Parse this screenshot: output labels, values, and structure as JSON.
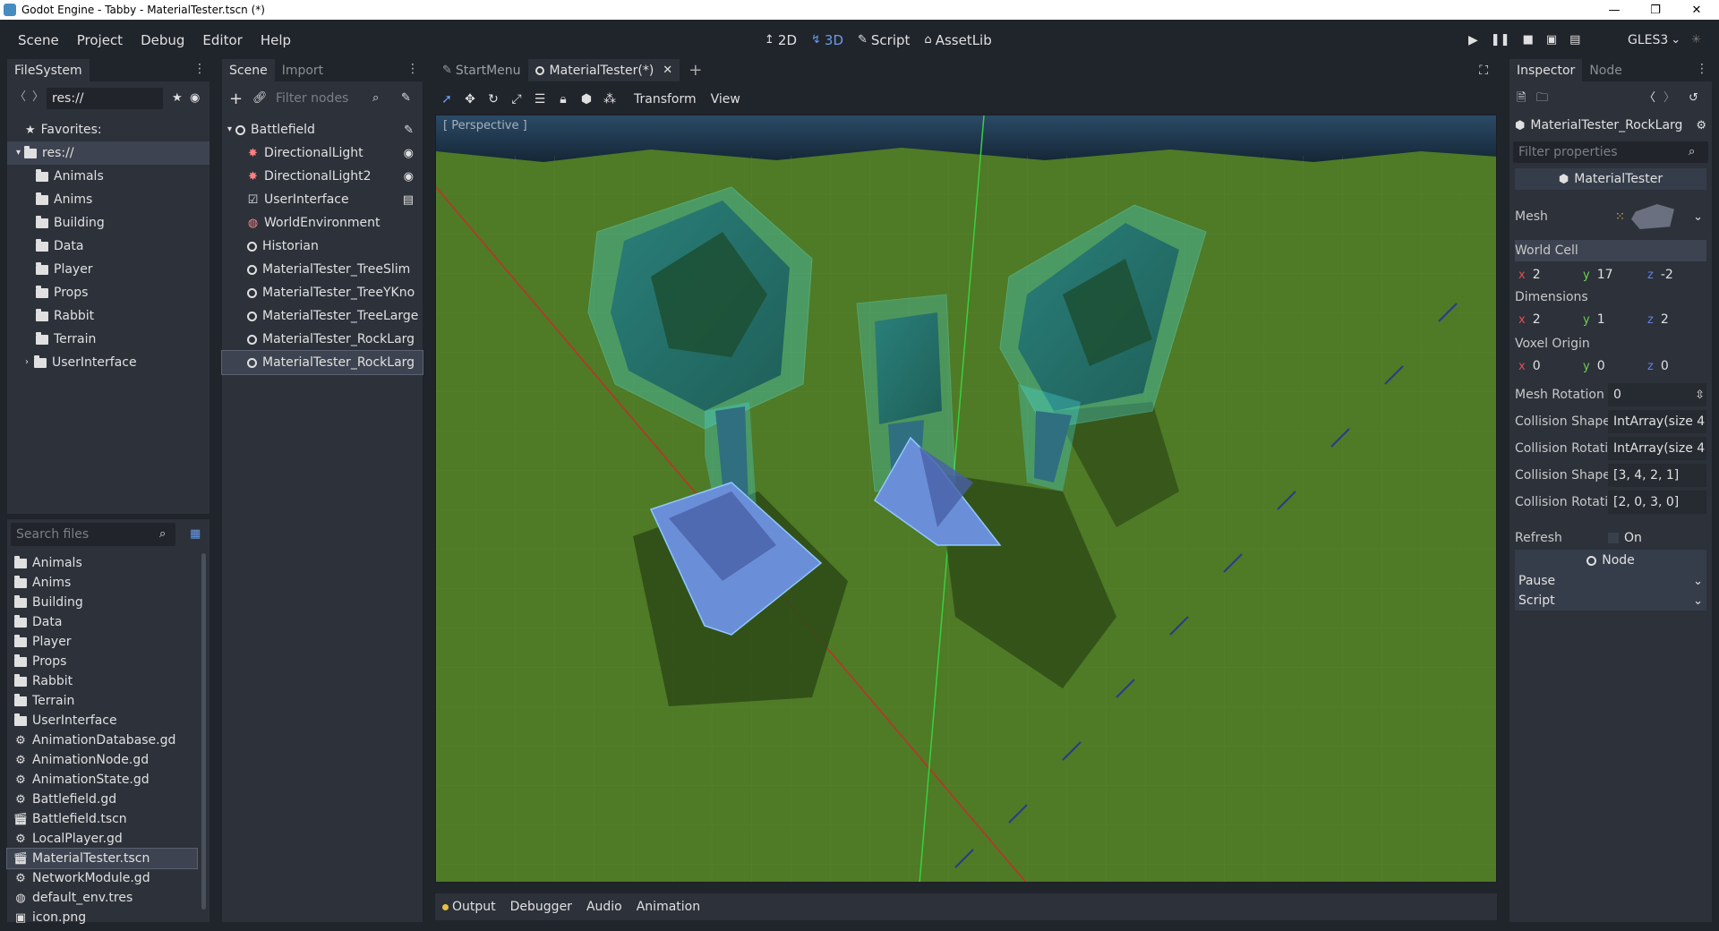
{
  "window": {
    "title": "Godot Engine - Tabby - MaterialTester.tscn (*)",
    "min": "—",
    "max": "❐",
    "close": "✕"
  },
  "menus": [
    "Scene",
    "Project",
    "Debug",
    "Editor",
    "Help"
  ],
  "workspaces": [
    {
      "label": "2D",
      "icon": "↥"
    },
    {
      "label": "3D",
      "icon": "↯"
    },
    {
      "label": "Script",
      "icon": "✎"
    },
    {
      "label": "AssetLib",
      "icon": "⌂"
    }
  ],
  "renderer": "GLES3",
  "filesystem": {
    "tabs": [
      "FileSystem"
    ],
    "path": "res://",
    "favorites_label": "Favorites:",
    "root": "res://",
    "tree": [
      "Animals",
      "Anims",
      "Building",
      "Data",
      "Player",
      "Props",
      "Rabbit",
      "Terrain",
      "UserInterface"
    ],
    "search_placeholder": "Search files",
    "files": [
      {
        "name": "Animals",
        "kind": "folder"
      },
      {
        "name": "Anims",
        "kind": "folder"
      },
      {
        "name": "Building",
        "kind": "folder"
      },
      {
        "name": "Data",
        "kind": "folder"
      },
      {
        "name": "Player",
        "kind": "folder"
      },
      {
        "name": "Props",
        "kind": "folder"
      },
      {
        "name": "Rabbit",
        "kind": "folder"
      },
      {
        "name": "Terrain",
        "kind": "folder"
      },
      {
        "name": "UserInterface",
        "kind": "folder"
      },
      {
        "name": "AnimationDatabase.gd",
        "kind": "script"
      },
      {
        "name": "AnimationNode.gd",
        "kind": "script"
      },
      {
        "name": "AnimationState.gd",
        "kind": "script"
      },
      {
        "name": "Battlefield.gd",
        "kind": "script"
      },
      {
        "name": "Battlefield.tscn",
        "kind": "scene"
      },
      {
        "name": "LocalPlayer.gd",
        "kind": "script"
      },
      {
        "name": "MaterialTester.tscn",
        "kind": "scene"
      },
      {
        "name": "NetworkModule.gd",
        "kind": "script"
      },
      {
        "name": "default_env.tres",
        "kind": "resource"
      },
      {
        "name": "icon.png",
        "kind": "image"
      }
    ]
  },
  "scene": {
    "tabs": [
      "Scene",
      "Import"
    ],
    "filter_placeholder": "Filter nodes",
    "root": "Battlefield",
    "nodes": [
      {
        "name": "DirectionalLight",
        "icon": "light-icon",
        "action": "visibility-icon"
      },
      {
        "name": "DirectionalLight2",
        "icon": "light-icon",
        "action": "visibility-icon"
      },
      {
        "name": "UserInterface",
        "icon": "control-icon",
        "action": "film-icon"
      },
      {
        "name": "WorldEnvironment",
        "icon": "globe-icon",
        "action": ""
      },
      {
        "name": "Historian",
        "icon": "node-icon",
        "action": ""
      },
      {
        "name": "MaterialTester_TreeSlim",
        "icon": "node-icon",
        "action": ""
      },
      {
        "name": "MaterialTester_TreeYKno",
        "icon": "node-icon",
        "action": ""
      },
      {
        "name": "MaterialTester_TreeLarge",
        "icon": "node-icon",
        "action": ""
      },
      {
        "name": "MaterialTester_RockLarg",
        "icon": "node-icon",
        "action": ""
      },
      {
        "name": "MaterialTester_RockLarg",
        "icon": "node-icon",
        "action": ""
      }
    ]
  },
  "editor_tabs": [
    "StartMenu",
    "MaterialTester(*)"
  ],
  "viewport": {
    "toolbar": [
      "Transform",
      "View"
    ],
    "label": "[ Perspective ]"
  },
  "bottom_tabs": [
    "Output",
    "Debugger",
    "Audio",
    "Animation"
  ],
  "inspector": {
    "tabs": [
      "Inspector",
      "Node"
    ],
    "object_name": "MaterialTester_RockLarg",
    "filter_placeholder": "Filter properties",
    "section_title": "MaterialTester",
    "mesh_label": "Mesh",
    "world_cell": {
      "label": "World Cell",
      "x": "2",
      "y": "17",
      "z": "-2"
    },
    "dimensions": {
      "label": "Dimensions",
      "x": "2",
      "y": "1",
      "z": "2"
    },
    "voxel_origin": {
      "label": "Voxel Origin",
      "x": "0",
      "y": "0",
      "z": "0"
    },
    "props": [
      {
        "label": "Mesh Rotation",
        "value": "0"
      },
      {
        "label": "Collision Shape",
        "value": "IntArray(size 4"
      },
      {
        "label": "Collision Rotati",
        "value": "IntArray(size 4"
      },
      {
        "label": "Collision Shape",
        "value": "[3, 4, 2, 1]"
      },
      {
        "label": "Collision Rotati",
        "value": "[2, 0, 3, 0]"
      }
    ],
    "refresh": {
      "label": "Refresh",
      "value": "On"
    },
    "node_section": "Node",
    "node_props": [
      "Pause",
      "Script"
    ]
  },
  "colors": {
    "bg": "#20242b",
    "panel": "#2c313a",
    "accent": "#699ce8",
    "selected": "#3d4350",
    "ground": "#4f7a26"
  }
}
